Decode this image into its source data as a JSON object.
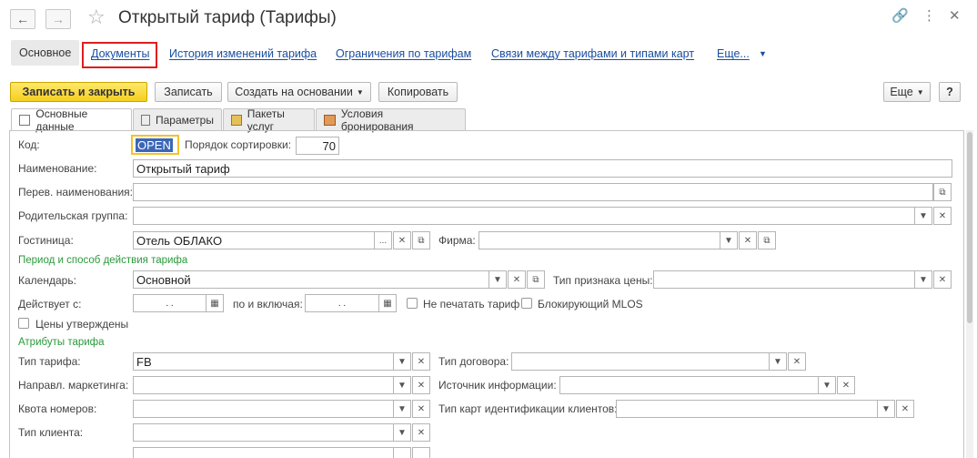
{
  "window": {
    "title": "Открытый тариф (Тарифы)",
    "back_icon": "arrow-left-icon",
    "forward_icon": "arrow-right-icon",
    "star_icon": "star-icon",
    "link_icon": "link-icon",
    "more_icon": "vertical-dots-icon",
    "close_icon": "close-icon"
  },
  "nav": {
    "main": "Основное",
    "documents": "Документы",
    "history": "История изменений тарифа",
    "restrictions": "Ограничения по тарифам",
    "links": "Связи между тарифами и типами карт",
    "more": "Еще..."
  },
  "toolbar": {
    "save_close": "Записать и закрыть",
    "save": "Записать",
    "create_based": "Создать на основании",
    "copy": "Копировать",
    "more": "Еще",
    "help": "?"
  },
  "tabs": {
    "main_data": "Основные данные",
    "params": "Параметры",
    "packages": "Пакеты услуг",
    "booking": "Условия бронирования"
  },
  "form": {
    "code_label": "Код:",
    "code_value": "OPEN",
    "sort_label": "Порядок сортировки:",
    "sort_value": "70",
    "name_label": "Наименование:",
    "name_value": "Открытый тариф",
    "trans_label": "Перев. наименования:",
    "trans_value": "",
    "parent_label": "Родительская группа:",
    "parent_value": "",
    "hotel_label": "Гостиница:",
    "hotel_value": "Отель ОБЛАКО",
    "firm_label": "Фирма:",
    "firm_value": "",
    "period_section": "Период и способ действия тарифа",
    "calendar_label": "Календарь:",
    "calendar_value": "Основной",
    "price_type_label": "Тип признака цены:",
    "price_type_value": "",
    "valid_from_label": "Действует с:",
    "valid_from_value": ". .",
    "valid_to_label": "по и включая:",
    "valid_to_value": ". .",
    "no_print_label": "Не печатать тариф",
    "mlos_label": "Блокирующий MLOS",
    "approved_label": "Цены утверждены",
    "attrs_section": "Атрибуты тарифа",
    "tariff_type_label": "Тип тарифа:",
    "tariff_type_value": "FB",
    "contract_type_label": "Тип договора:",
    "contract_type_value": "",
    "marketing_label": "Направл. маркетинга:",
    "marketing_value": "",
    "info_source_label": "Источник информации:",
    "info_source_value": "",
    "quota_label": "Квота номеров:",
    "quota_value": "",
    "client_cards_label": "Тип карт идентификации клиентов:",
    "client_cards_value": "",
    "client_type_label": "Тип клиента:",
    "client_type_value": ""
  },
  "colors": {
    "accent_yellow": "#f5cf1f",
    "link_blue": "#1a4fa0",
    "section_green": "#2a9a3a",
    "highlight_red": "#e01d1d",
    "focus_orange": "#f3c22c"
  }
}
